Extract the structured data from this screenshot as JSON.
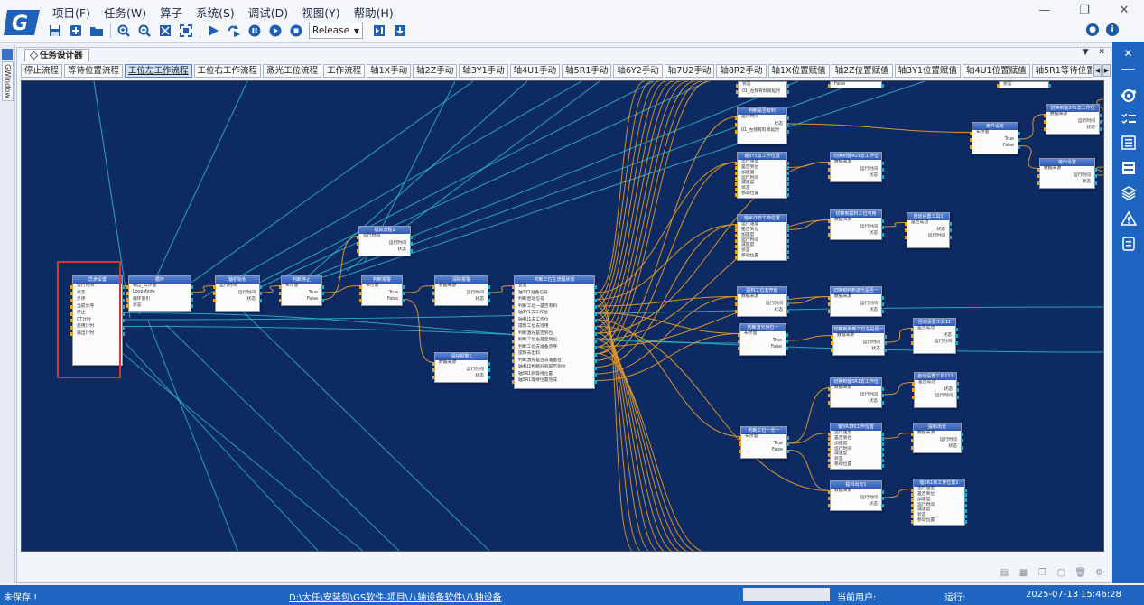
{
  "menu": [
    "项目(F)",
    "任务(W)",
    "算子",
    "系统(S)",
    "调试(D)",
    "视图(Y)",
    "帮助(H)"
  ],
  "toolbar": {
    "build_config": "Release"
  },
  "left_strip": {
    "tab": "GWindow"
  },
  "doc_tab": "任务设计器",
  "flow_tabs": [
    "停止流程",
    "等待位置流程",
    "工位左工作流程",
    "工位右工作流程",
    "激光工位流程",
    "工作流程",
    "轴1X手动",
    "轴2Z手动",
    "轴3Y1手动",
    "轴4U1手动",
    "轴5R1手动",
    "轴6Y2手动",
    "轴7U2手动",
    "轴8R2手动",
    "轴1X位置赋值",
    "轴2Z位置赋值",
    "轴3Y1位置赋值",
    "轴4U1位置赋值",
    "轴5R1等待位置"
  ],
  "active_flow_tab": 2,
  "nodes": [
    {
      "id": "n1",
      "title": "异步设置",
      "left": [
        "运行时间",
        "状态",
        "步序",
        "当前步序",
        "停止",
        "CT计时",
        "启用计时",
        "输出计时"
      ],
      "right": [],
      "highlight": true
    },
    {
      "id": "n2",
      "title": "循环",
      "left": [
        "输出_异步量",
        "LoopMode",
        "循环索引",
        "状态"
      ],
      "right": []
    },
    {
      "id": "n3",
      "title": "轴初始化",
      "left": [
        "运行时间",
        "运行时间",
        "状态"
      ],
      "right": []
    },
    {
      "id": "n4",
      "title": "判断停止",
      "left": [
        "布尔量",
        "True",
        "False"
      ],
      "right": []
    },
    {
      "id": "n5",
      "title": "模拟流程1",
      "left": [
        "运行时间",
        "运行时间",
        "状态"
      ],
      "right": []
    },
    {
      "id": "n6",
      "title": "判断报警",
      "left": [
        "布尔量",
        "True",
        "False"
      ],
      "right": []
    },
    {
      "id": "n7",
      "title": "清除报警",
      "left": [
        "数据来源",
        "运行时间",
        "状态"
      ],
      "right": []
    },
    {
      "id": "n8",
      "title": "清除报警1",
      "left": [
        "数据来源",
        "运行时间",
        "状态"
      ],
      "right": []
    },
    {
      "id": "n9",
      "title": "判断工位左流程状态",
      "left": [
        "变量",
        "轴3Y1准备信号",
        "判断启动信号",
        "判断工位一是否有料",
        "轴3Y1去工作位",
        "轴4U1去工作位",
        "提料工位去可用",
        "判断激光是否到位",
        "判断工位左是否到位",
        "判断工位去准备步序",
        "提料去出料",
        "判断激光是否去准备位",
        "轴4U1判断升到是否到位",
        "轴5R1到等待位置",
        "轴5R1等待位置完成"
      ],
      "right": []
    },
    {
      "id": "n10",
      "title": "判断是否有料",
      "left": [
        "运行时间",
        "状态",
        "01_左侧有料真延时"
      ],
      "right": []
    },
    {
      "id": "n11",
      "title": "轴3Y1去工作位置",
      "left": [
        "运行速度",
        "是否到位",
        "加速度",
        "运行时间",
        "减速度",
        "状态",
        "移动位置"
      ],
      "right": []
    },
    {
      "id": "n12",
      "title": "切换到轴4U1去工作位",
      "left": [
        "数据来源",
        "运行时间",
        "状态"
      ],
      "right": []
    },
    {
      "id": "n13",
      "title": "轴4U1去工作位置",
      "left": [
        "运行速度",
        "是否到位",
        "加速度",
        "运行时间",
        "减速度",
        "状态",
        "移动位置"
      ],
      "right": []
    },
    {
      "id": "n14",
      "title": "切换到提料工位可用",
      "left": [
        "数据来源",
        "运行时间",
        "状态"
      ],
      "right": []
    },
    {
      "id": "n15",
      "title": "自动设置工具1",
      "left": [
        "是否成功",
        "状态",
        "运行时间"
      ],
      "right": []
    },
    {
      "id": "n16",
      "title": "提料工位去开始",
      "left": [
        "数据来源",
        "运行时间",
        "状态"
      ],
      "right": []
    },
    {
      "id": "n17",
      "title": "切换到判断激光是否一",
      "left": [
        "数据来源",
        "运行时间",
        "状态"
      ],
      "right": []
    },
    {
      "id": "n18",
      "title": "判断激光到位一",
      "left": [
        "布尔量",
        "True",
        "False"
      ],
      "right": []
    },
    {
      "id": "n19",
      "title": "切换到判断工位左是否一",
      "left": [
        "数据来源",
        "运行时间",
        "状态"
      ],
      "right": []
    },
    {
      "id": "n20",
      "title": "自动设置工具11",
      "left": [
        "是否成功",
        "状态",
        "运行时间"
      ],
      "right": []
    },
    {
      "id": "n21",
      "title": "切换到轴5R1去工作位",
      "left": [
        "数据来源",
        "运行时间",
        "状态"
      ],
      "right": []
    },
    {
      "id": "n22",
      "title": "自动设置工具111",
      "left": [
        "是否成功",
        "状态",
        "运行时间"
      ],
      "right": []
    },
    {
      "id": "n23",
      "title": "判断工位一无一",
      "left": [
        "布尔量",
        "True",
        "False"
      ],
      "right": []
    },
    {
      "id": "n24",
      "title": "轴5R1到工作位置",
      "left": [
        "运行速度",
        "是否到位",
        "加速度",
        "运行时间",
        "减速度",
        "状态",
        "移动位置"
      ],
      "right": []
    },
    {
      "id": "n25",
      "title": "提料出光",
      "left": [
        "数据来源",
        "运行时间",
        "状态"
      ],
      "right": []
    },
    {
      "id": "n26",
      "title": "提料出光1",
      "left": [
        "数据来源",
        "运行时间",
        "状态"
      ],
      "right": []
    },
    {
      "id": "n27",
      "title": "轴5R1到工作位置1",
      "left": [
        "运行速度",
        "是否到位",
        "加速度",
        "运行时间",
        "减速度",
        "状态",
        "移动位置"
      ],
      "right": []
    },
    {
      "id": "n28",
      "title": "条件设定",
      "left": [
        "布尔量",
        "True",
        "False"
      ],
      "right": []
    },
    {
      "id": "n29",
      "title": "切换到轴3Y1去工作位",
      "left": [
        "数据来源",
        "运行时间",
        "状态"
      ],
      "right": []
    },
    {
      "id": "n30",
      "title": "输出设置",
      "left": [
        "数据来源",
        "运行时间",
        "状态"
      ],
      "right": []
    },
    {
      "id": "n31",
      "title": "",
      "left": [
        "状态",
        "01_左侧有料真延时"
      ],
      "right": []
    },
    {
      "id": "n32",
      "title": "",
      "left": [
        "False"
      ],
      "right": []
    },
    {
      "id": "n33",
      "title": "",
      "left": [
        "状态"
      ],
      "right": []
    }
  ],
  "status": {
    "save_state": "未保存 !",
    "project_path": "D:\\大任\\安装包\\GS软件-项目\\八轴设备软件\\八轴设备",
    "user_label": "当前用户:",
    "run_label": "运行:",
    "date": "2025-07-13",
    "time": "15:46:28"
  },
  "colors": {
    "canvas_bg": "#0e2a62",
    "wire_teal": "#2fc3d6",
    "wire_orange": "#e39a2c",
    "node_header": "#3a67c4",
    "statusbar": "#1e66c2",
    "highlight": "#e03030"
  }
}
